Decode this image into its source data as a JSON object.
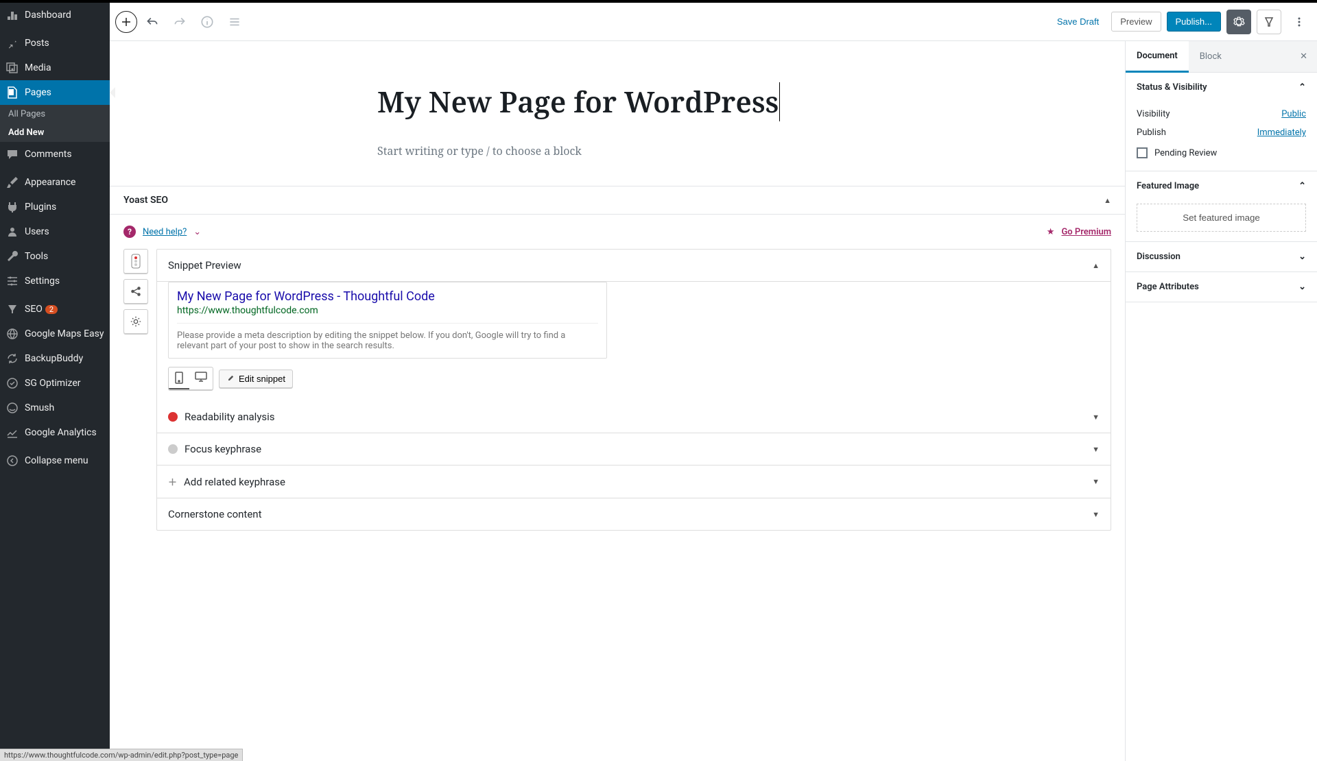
{
  "sidebar": {
    "items": [
      {
        "label": "Dashboard",
        "icon": "dashboard"
      },
      {
        "label": "Posts",
        "icon": "pin"
      },
      {
        "label": "Media",
        "icon": "media"
      },
      {
        "label": "Pages",
        "icon": "pages",
        "active": true
      },
      {
        "label": "Comments",
        "icon": "comment"
      },
      {
        "label": "Appearance",
        "icon": "brush"
      },
      {
        "label": "Plugins",
        "icon": "plug"
      },
      {
        "label": "Users",
        "icon": "user"
      },
      {
        "label": "Tools",
        "icon": "wrench"
      },
      {
        "label": "Settings",
        "icon": "sliders"
      },
      {
        "label": "SEO",
        "icon": "yoast",
        "badge": "2"
      },
      {
        "label": "Google Maps Easy",
        "icon": "globe"
      },
      {
        "label": "BackupBuddy",
        "icon": "refresh"
      },
      {
        "label": "SG Optimizer",
        "icon": "sg"
      },
      {
        "label": "Smush",
        "icon": "smush"
      },
      {
        "label": "Google Analytics",
        "icon": "chart"
      },
      {
        "label": "Collapse menu",
        "icon": "collapse"
      }
    ],
    "sub": {
      "all": "All Pages",
      "add": "Add New"
    }
  },
  "topbar": {
    "save_draft": "Save Draft",
    "preview": "Preview",
    "publish": "Publish..."
  },
  "editor": {
    "title": "My New Page for WordPress",
    "prompt": "Start writing or type / to choose a block"
  },
  "yoast": {
    "title": "Yoast SEO",
    "need_help": "Need help?",
    "go_premium": "Go Premium",
    "snippet_preview": "Snippet Preview",
    "snippet_title": "My New Page for WordPress - Thoughtful Code",
    "snippet_url": "https://www.thoughtfulcode.com",
    "snippet_desc": "Please provide a meta description by editing the snippet below. If you don't, Google will try to find a relevant part of your post to show in the search results.",
    "edit_snippet": "Edit snippet",
    "readability": "Readability analysis",
    "focus_keyphrase": "Focus keyphrase",
    "add_related": "Add related keyphrase",
    "cornerstone": "Cornerstone content"
  },
  "rightpanel": {
    "tabs": {
      "document": "Document",
      "block": "Block"
    },
    "status_visibility": "Status & Visibility",
    "visibility": "Visibility",
    "visibility_value": "Public",
    "publish": "Publish",
    "publish_value": "Immediately",
    "pending_review": "Pending Review",
    "featured_image": "Featured Image",
    "set_featured": "Set featured image",
    "discussion": "Discussion",
    "page_attributes": "Page Attributes"
  },
  "status_url": "https://www.thoughtfulcode.com/wp-admin/edit.php?post_type=page"
}
